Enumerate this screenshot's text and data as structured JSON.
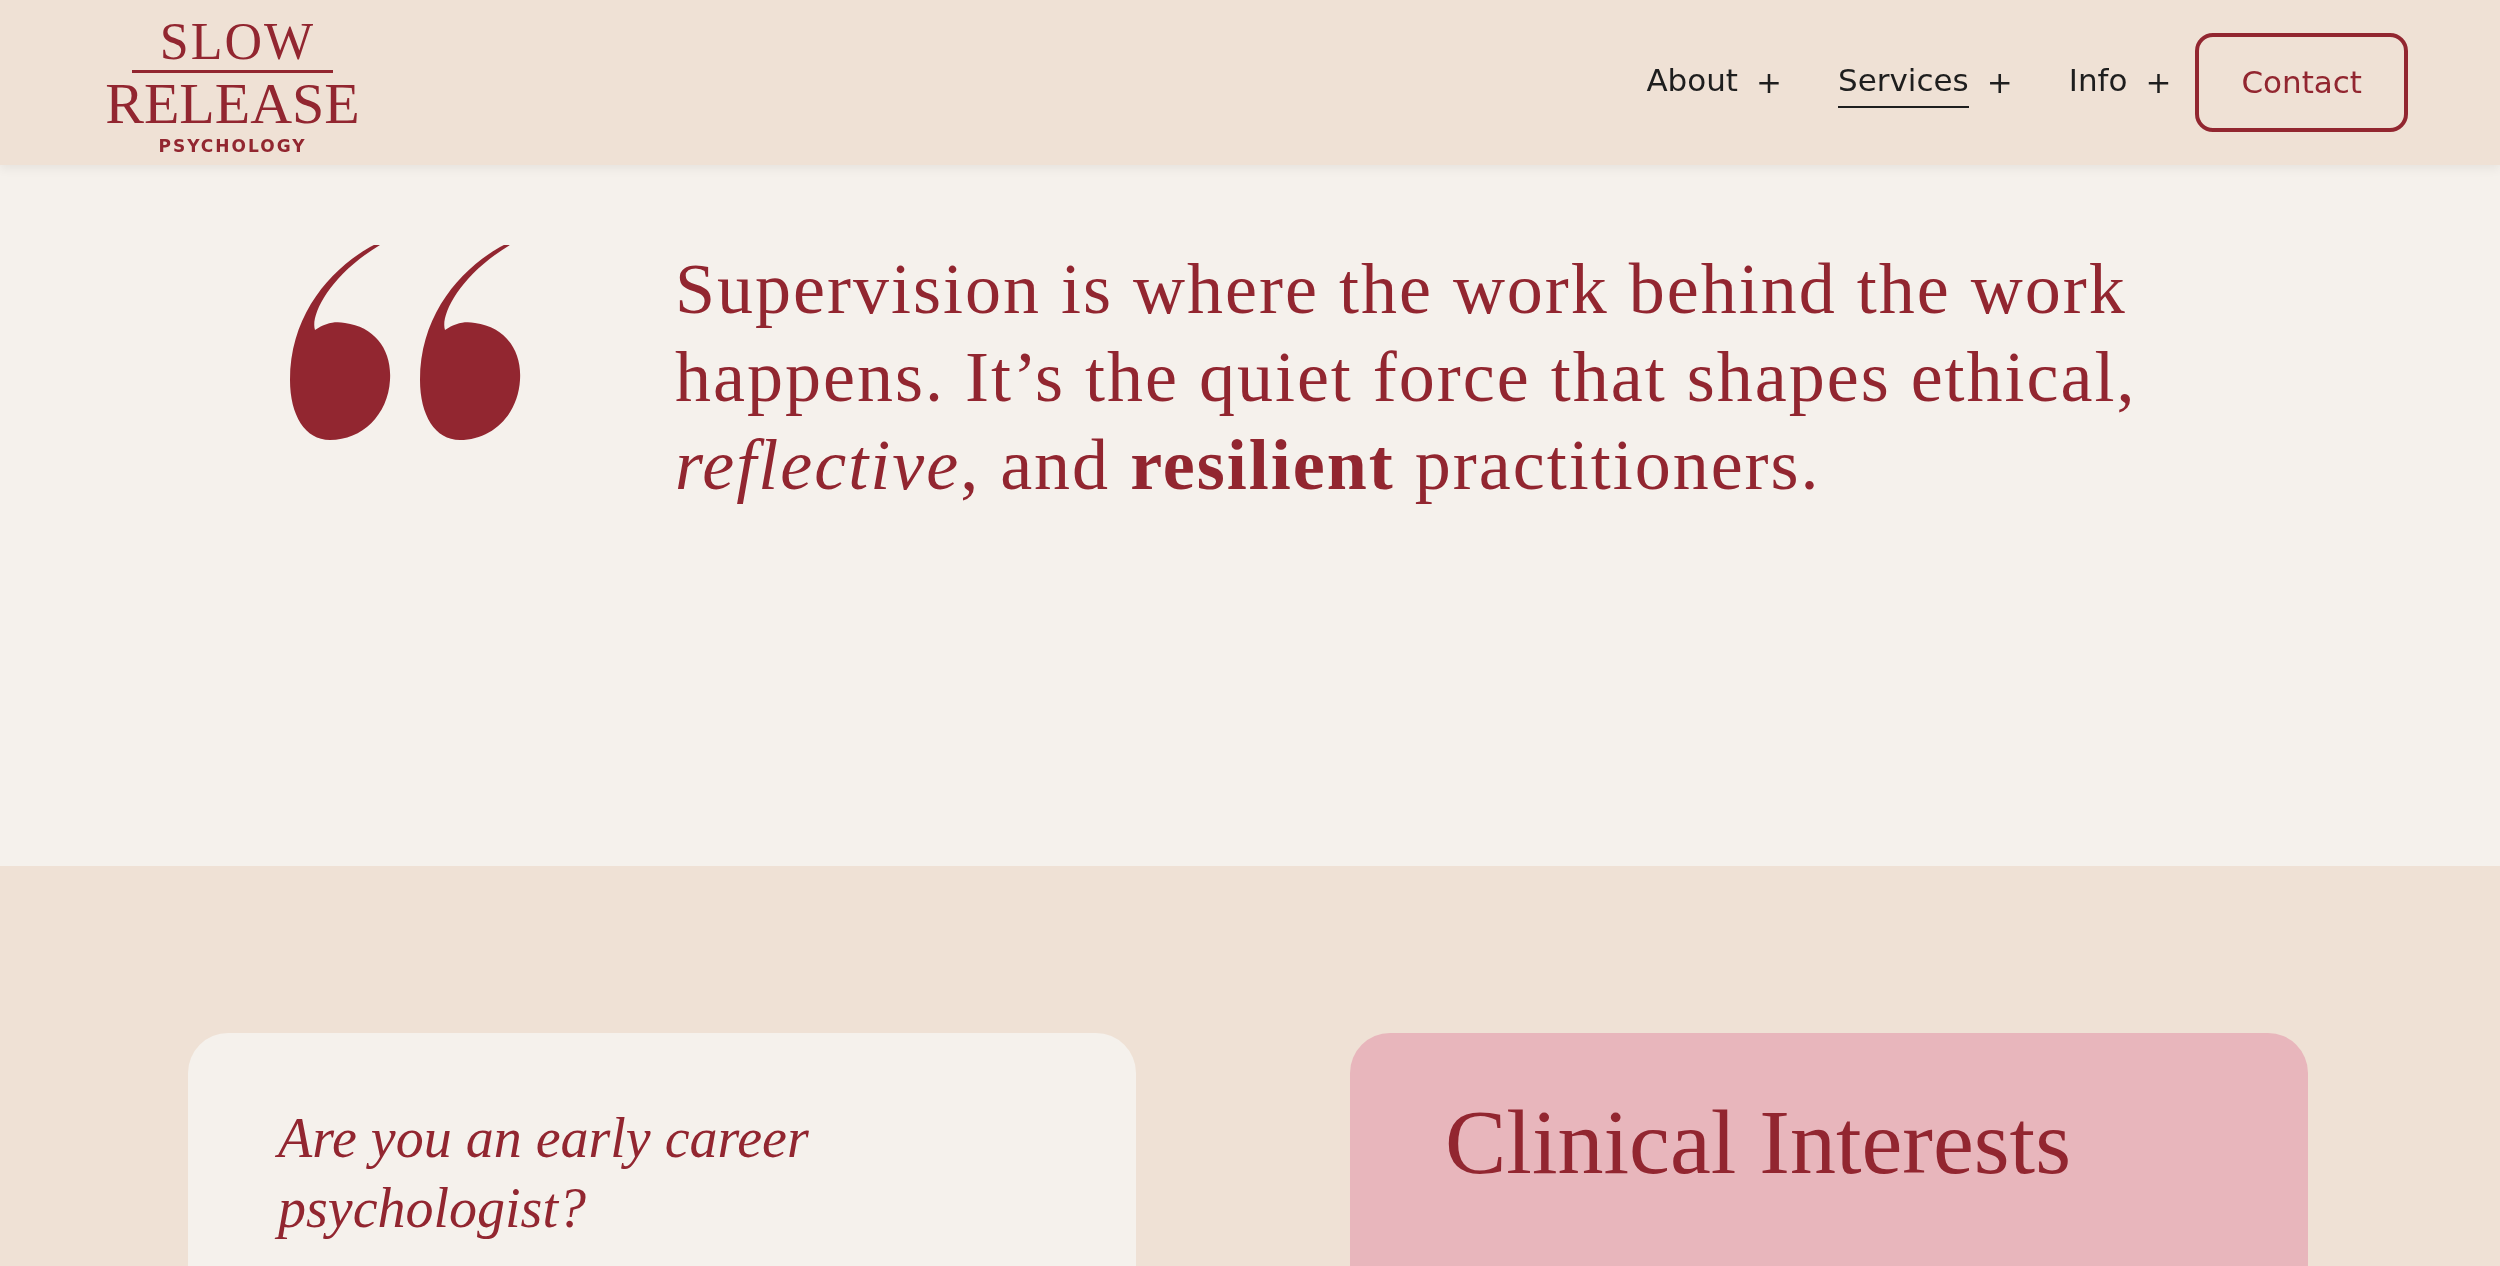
{
  "logo": {
    "line_1": "SLOW",
    "line_2": "RELEASE",
    "line_3": "PSYCHOLOGY"
  },
  "nav": [
    {
      "label": "About",
      "toggle": "+",
      "selected": false
    },
    {
      "label": "Services",
      "toggle": "+",
      "selected": true
    },
    {
      "label": "Info",
      "toggle": "+",
      "selected": false
    }
  ],
  "contact_button": "Contact",
  "quote": {
    "text": "Supervision is where the work behind the work happens. It’s the quiet force that shapes ethical, *reflective*, and **resilient** practitioners."
  },
  "cards": [
    {
      "kind": "question",
      "text": "Are you an early career psychologist?"
    },
    {
      "kind": "heading",
      "text": "Clinical Interests"
    }
  ]
}
